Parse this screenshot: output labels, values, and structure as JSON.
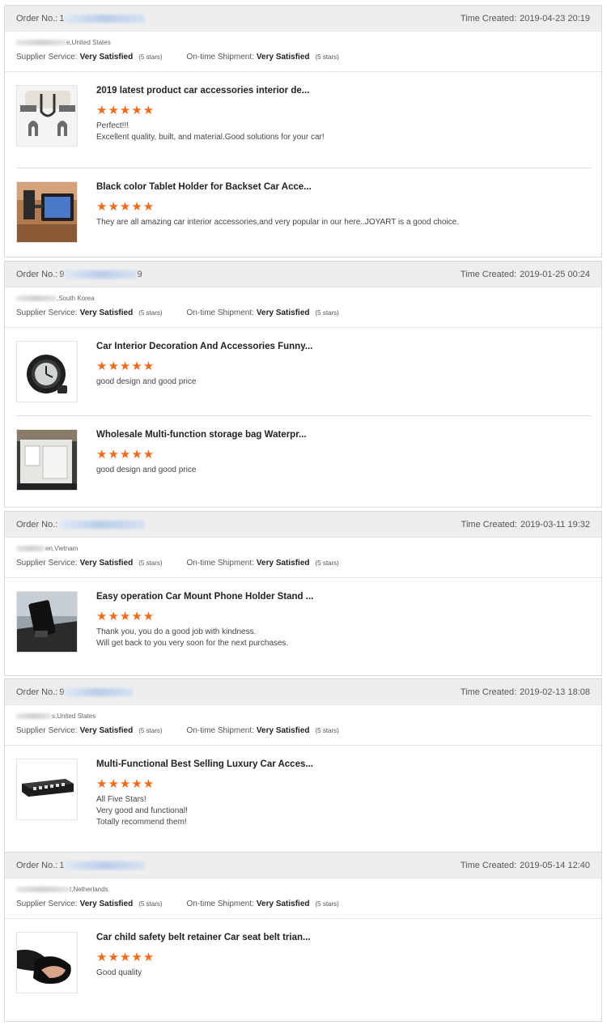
{
  "labels": {
    "order_no": "Order No.:",
    "time_created": "Time Created:",
    "supplier_service": "Supplier Service:",
    "ontime_shipment": "On-time Shipment:",
    "very_satisfied": "Very Satisfied",
    "five_stars": "(5 stars)",
    "stars": "★★★★★"
  },
  "orders": [
    {
      "order_no_prefix": "1",
      "time": "2019-04-23 20:19",
      "location": "e,United States",
      "items": [
        {
          "title": "2019 latest product car accessories interior de...",
          "comment": [
            "Perfect!!!",
            "Excellent quality, built, and material.Good solutions for your car!"
          ]
        },
        {
          "title": "Black color Tablet Holder for Backset Car Acce...",
          "comment": [
            "They are all amazing car interior accessories,and very popular in our here..JOYART is a good choice."
          ]
        }
      ]
    },
    {
      "order_no_prefix": "9",
      "order_no_suffix": "9",
      "time": "2019-01-25 00:24",
      "location": ",South Korea",
      "items": [
        {
          "title": "Car Interior Decoration And Accessories Funny...",
          "comment": [
            "good design and good price"
          ]
        },
        {
          "title": "Wholesale Multi-function storage bag Waterpr...",
          "comment": [
            "good design and good price"
          ]
        }
      ]
    },
    {
      "order_no_prefix": "",
      "time": "2019-03-11 19:32",
      "location": "en,Vietnam",
      "items": [
        {
          "title": "Easy operation Car Mount Phone Holder Stand ...",
          "comment": [
            "Thank you, you do a good job with kindness.",
            "Will get back to you very soon for the next purchases."
          ]
        }
      ]
    },
    {
      "order_no_prefix": "9",
      "time": "2019-02-13 18:08",
      "location": "s,United States",
      "items": [
        {
          "title": "Multi-Functional Best Selling Luxury Car Acces...",
          "comment": [
            "All Five Stars!",
            "Very good and functional!",
            "Totally recommend them!"
          ]
        }
      ]
    },
    {
      "order_no_prefix": "1",
      "time": "2019-05-14 12:40",
      "location": "t,Netherlands",
      "items": [
        {
          "title": "Car child safety belt retainer Car seat belt trian...",
          "comment": [
            "Good quality"
          ]
        }
      ]
    }
  ]
}
